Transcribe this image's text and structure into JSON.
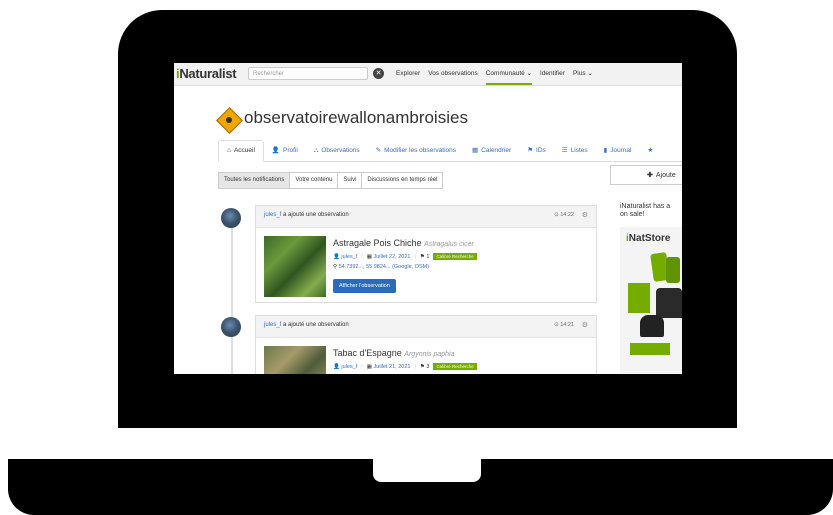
{
  "nav": {
    "logo": "iNaturalist",
    "logo_i": "i",
    "logo_rest": "Naturalist",
    "search_placeholder": "Rechercher",
    "items": [
      "Explorer",
      "Vos observations",
      "Communauté ⌄",
      "Identifier",
      "Plus ⌄"
    ],
    "active_index": 2
  },
  "project": {
    "title": "observatoirewallonambroisies"
  },
  "tabs": [
    {
      "icon": "⌂",
      "label": "Accueil"
    },
    {
      "icon": "👤",
      "label": "Profil"
    },
    {
      "icon": "⛬",
      "label": "Observations"
    },
    {
      "icon": "✎",
      "label": "Modifier les observations"
    },
    {
      "icon": "▦",
      "label": "Calendrier"
    },
    {
      "icon": "⚑",
      "label": "IDs"
    },
    {
      "icon": "☰",
      "label": "Listes"
    },
    {
      "icon": "▮",
      "label": "Journal"
    },
    {
      "icon": "★",
      "label": ""
    }
  ],
  "subtabs": [
    "Toutes les notifications",
    "Votre contenu",
    "Suivi",
    "Discussions en temps réel"
  ],
  "feed": [
    {
      "user": "jules_f",
      "action": " a ajouté une observation",
      "time": "⊙ 14:22",
      "common_name": "Astragale Pois Chiche",
      "sci_name": "Astragalus cicer",
      "observer": "jules_f",
      "date": "Juillet 22, 2021",
      "id_count": "1",
      "quality": "Calibre Recherche",
      "coords": "54.7392..., 55.9824... (Google, OSM)",
      "button": "Afficher l'observation"
    },
    {
      "user": "jules_f",
      "action": " a ajouté une observation",
      "time": "⊙ 14:21",
      "common_name": "Tabac d'Espagne",
      "sci_name": "Argynnis paphia",
      "observer": "jules_f",
      "date": "Juillet 21, 2021",
      "id_count": "3",
      "quality": "Calibre Recherche"
    }
  ],
  "sidebar": {
    "add_label": "Ajoute",
    "promo_line1": "iNaturalist has a",
    "promo_line2": "on sale!",
    "store_i": "i",
    "store_rest": "NatStore"
  },
  "colors": {
    "brand_green": "#74ac00",
    "link_blue": "#3a6fbf",
    "button_blue": "#2b6cb8"
  }
}
